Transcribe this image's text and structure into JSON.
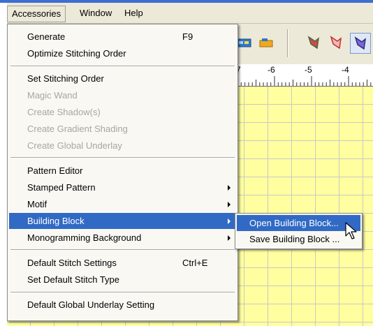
{
  "menubar": {
    "items": [
      "Accessories",
      "Window",
      "Help"
    ]
  },
  "ruler": {
    "labels": [
      "7",
      "-6",
      "-5",
      "-4"
    ]
  },
  "menu": {
    "items": [
      {
        "label": "Generate",
        "shortcut": "F9",
        "enabled": true
      },
      {
        "label": "Optimize Stitching Order",
        "enabled": true
      },
      {
        "label": "Set Stitching Order",
        "enabled": true
      },
      {
        "label": "Magic Wand",
        "enabled": false
      },
      {
        "label": "Create Shadow(s)",
        "enabled": false
      },
      {
        "label": "Create Gradient Shading",
        "enabled": false
      },
      {
        "label": "Create Global Underlay",
        "enabled": false
      },
      {
        "label": "Pattern Editor",
        "enabled": true
      },
      {
        "label": "Stamped Pattern",
        "enabled": true,
        "submenu": true
      },
      {
        "label": "Motif",
        "enabled": true,
        "submenu": true
      },
      {
        "label": "Building Block",
        "enabled": true,
        "submenu": true,
        "highlighted": true
      },
      {
        "label": "Monogramming Background",
        "enabled": true,
        "submenu": true
      },
      {
        "label": "Default Stitch Settings",
        "shortcut": "Ctrl+E",
        "enabled": true
      },
      {
        "label": "Set Default Stitch Type",
        "enabled": true
      },
      {
        "label": "Default Global Underlay Setting",
        "enabled": true
      }
    ]
  },
  "submenu": {
    "items": [
      {
        "label": "Open Building Block...",
        "highlighted": true
      },
      {
        "label": "Save Building Block ..."
      }
    ]
  },
  "icons": {
    "toolbar": [
      "design-tool-icon-1",
      "design-tool-icon-2",
      "stitch-shape-icon-1",
      "stitch-shape-icon-2",
      "stitch-shape-icon-3"
    ],
    "cursor": "mouse-pointer-icon"
  },
  "colors": {
    "highlight": "#316ac5",
    "menu_background": "#f9f8f3",
    "canvas_background": "#ffff9f",
    "disabled_text": "#a7a6a0"
  }
}
